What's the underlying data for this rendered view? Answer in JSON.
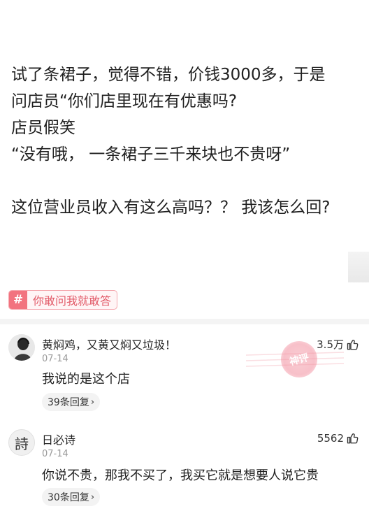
{
  "post": {
    "lines": [
      "试了条裙子，觉得不错，价钱3000多，于是",
      "问店员“你们店里现在有优惠吗?",
      "店员假笑",
      "“没有哦， 一条裙子三千来块也不贵呀”",
      "这位营业员收入有这么高吗？？ 我该怎么回?"
    ]
  },
  "topic_tag": {
    "icon": "#",
    "label": "你敢问我就敢答"
  },
  "comments": [
    {
      "username": "黄焖鸡，又黄又焖又垃圾！",
      "date": "07-14",
      "likes": "3.5万",
      "text": "我说的是这个店",
      "replies": "39条回复",
      "avatar_icon": "person-silhouette"
    },
    {
      "username": "日必诗",
      "date": "07-14",
      "likes": "5562",
      "text": "你说不贵，那我不买了，我买它就是想要人说它贵",
      "replies": "30条回复",
      "avatar_icon": "poem-character",
      "avatar_char": "詩"
    }
  ],
  "colors": {
    "accent": "#f2737f",
    "tag_text": "#e25a68"
  }
}
